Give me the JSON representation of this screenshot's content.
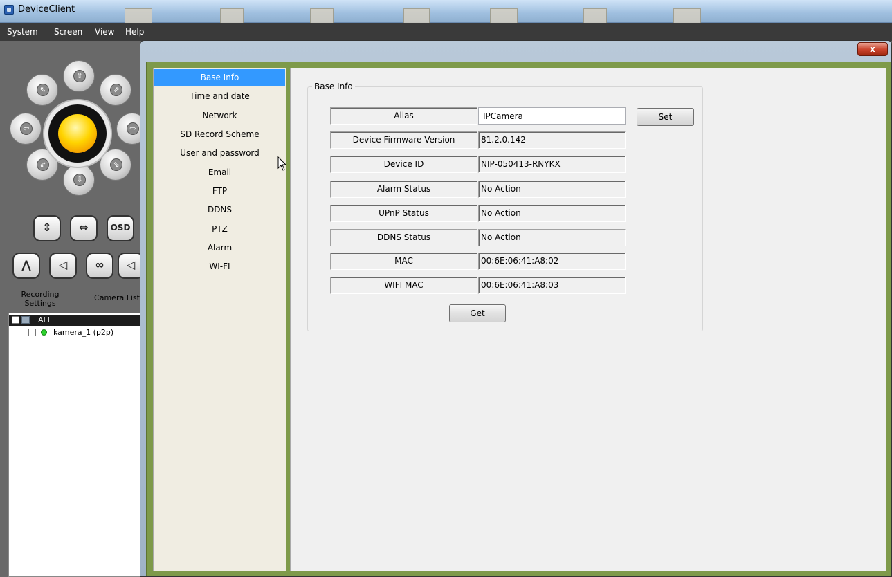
{
  "app": {
    "title": "DeviceClient"
  },
  "menu": [
    "System",
    "Screen",
    "View",
    "Help"
  ],
  "left_panel": {
    "ptz_arrows": [
      "⇧",
      "⇩",
      "⇦",
      "⇨",
      "⇖",
      "⇗",
      "⇙",
      "⇘"
    ],
    "tool_buttons_row1": [
      "⇕",
      "⇔",
      "OSD"
    ],
    "tool_buttons_row2": [
      "⋀",
      "◁",
      "∞",
      "◁"
    ],
    "recording_settings": "Recording Settings",
    "camera_list": "Camera List",
    "tree": {
      "all_label": "ALL",
      "camera": "kamera_1 (p2p)",
      "camera_status_color": "#2ed12e"
    }
  },
  "dialog": {
    "close_label": "x",
    "nav_items": [
      "Base Info",
      "Time and date",
      "Network",
      "SD Record Scheme",
      "User and password",
      "Email",
      "FTP",
      "DDNS",
      "PTZ",
      "Alarm",
      "WI-FI"
    ],
    "active_nav": "Base Info",
    "group_title": "Base Info",
    "fields": [
      {
        "label": "Alias",
        "value": "IPCamera",
        "editable": true
      },
      {
        "label": "Device Firmware Version",
        "value": "81.2.0.142",
        "editable": false
      },
      {
        "label": "Device ID",
        "value": "NIP-050413-RNYKX",
        "editable": false
      },
      {
        "label": "Alarm Status",
        "value": "No Action",
        "editable": false
      },
      {
        "label": "UPnP Status",
        "value": "No Action",
        "editable": false
      },
      {
        "label": "DDNS Status",
        "value": "No Action",
        "editable": false
      },
      {
        "label": "MAC",
        "value": "00:6E:06:41:A8:02",
        "editable": false
      },
      {
        "label": "WIFI MAC",
        "value": "00:6E:06:41:A8:03",
        "editable": false
      }
    ],
    "set_button": "Set",
    "get_button": "Get"
  },
  "colors": {
    "nav_active": "#3399ff",
    "dialog_frame": "#7e9a4a"
  }
}
